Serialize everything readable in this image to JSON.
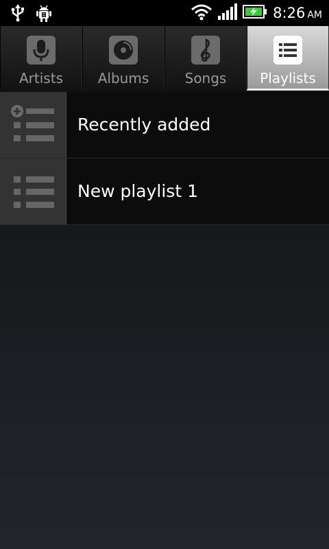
{
  "status_bar": {
    "left_icons": [
      "usb-icon",
      "android-debug-icon"
    ],
    "right_icons": [
      "wifi-icon",
      "signal-icon",
      "battery-charging-icon"
    ],
    "time": "8:26",
    "ampm": "AM"
  },
  "tabs": [
    {
      "label": "Artists",
      "icon": "microphone-icon",
      "active": false
    },
    {
      "label": "Albums",
      "icon": "disc-icon",
      "active": false
    },
    {
      "label": "Songs",
      "icon": "treble-clef-icon",
      "active": false
    },
    {
      "label": "Playlists",
      "icon": "list-icon",
      "active": true
    }
  ],
  "playlists": [
    {
      "label": "Recently added",
      "icon": "add-playlist-icon"
    },
    {
      "label": "New playlist 1",
      "icon": "playlist-icon"
    }
  ]
}
